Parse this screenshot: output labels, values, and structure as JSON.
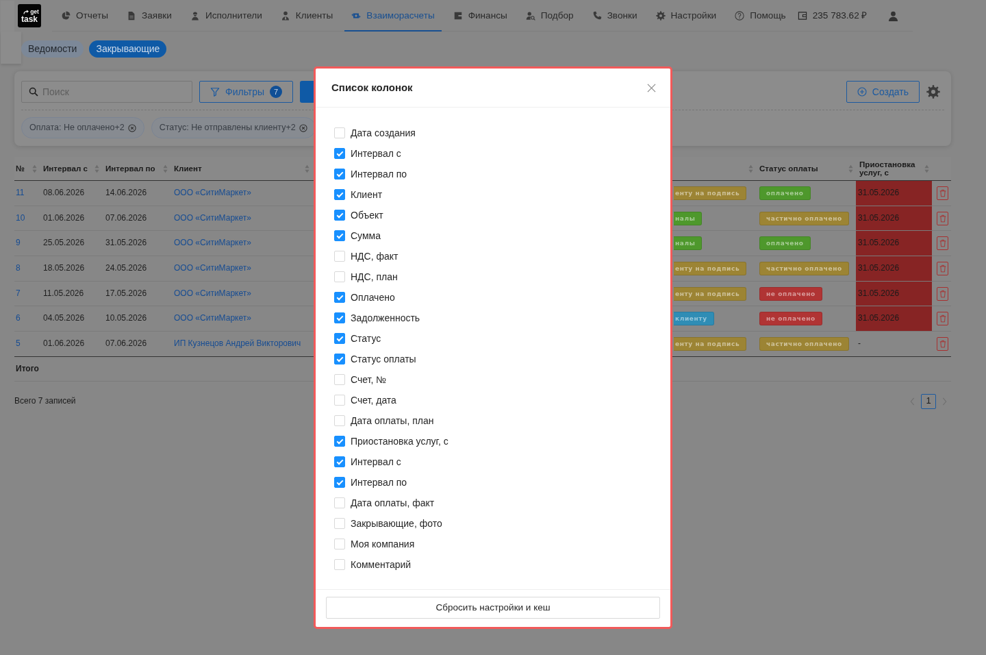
{
  "logo": {
    "line_1": "get",
    "line_2": "task"
  },
  "nav": {
    "items": [
      {
        "label": "Отчеты",
        "selected": false
      },
      {
        "label": "Заявки",
        "selected": false
      },
      {
        "label": "Исполнители",
        "selected": false
      },
      {
        "label": "Клиенты",
        "selected": false
      },
      {
        "label": "Взаиморасчеты",
        "selected": true
      },
      {
        "label": "Финансы",
        "selected": false
      },
      {
        "label": "Подбор",
        "selected": false
      },
      {
        "label": "Звонки",
        "selected": false
      },
      {
        "label": "Настройки",
        "selected": false
      },
      {
        "label": "Помощь",
        "selected": false
      }
    ],
    "balance": "235 783.62 ₽"
  },
  "subtabs": [
    {
      "label": "Ведомости",
      "selected": false
    },
    {
      "label": "Закрывающие",
      "selected": true
    }
  ],
  "toolbar": {
    "search": {
      "placeholder": "Поиск"
    },
    "filters_button": {
      "label": "Фильтры",
      "count": "7"
    },
    "create_button": {
      "label": "Создать"
    }
  },
  "active_filters": [
    {
      "label": "Оплата: Не оплачено+2"
    },
    {
      "label": "Статус: Не отправлены клиенту+2"
    }
  ],
  "table": {
    "columns": [
      {
        "label": "№",
        "sortable": true
      },
      {
        "label": "Интервал с",
        "sortable": true
      },
      {
        "label": "Интервал по",
        "sortable": true
      },
      {
        "label": "Клиент",
        "sortable": true
      },
      {
        "sortable": true
      },
      {
        "label": "Статус оплаты",
        "sortable": true
      },
      {
        "label": "Приостановка услуг, с",
        "sortable": true
      }
    ],
    "rows": [
      {
        "number": "11",
        "interval_from": "08.06.2026",
        "interval_to": "14.06.2026",
        "client": "ООО «СитиМаркет»",
        "status": {
          "text": "енту на подпись",
          "color": "#9c8434"
        },
        "payment_status": {
          "text": "оплачено",
          "color": "#4e982c"
        },
        "suspension_from": "31.05.2026",
        "highlighted": true
      },
      {
        "number": "10",
        "interval_from": "01.06.2026",
        "interval_to": "07.06.2026",
        "client": "ООО «СитиМаркет»",
        "status": {
          "text": "налы",
          "color": "#4e982c"
        },
        "payment_status": {
          "text": "частично оплачено",
          "color": "#9c8434"
        },
        "suspension_from": "31.05.2026",
        "highlighted": true
      },
      {
        "number": "9",
        "interval_from": "25.05.2026",
        "interval_to": "31.05.2026",
        "client": "ООО «СитиМаркет»",
        "status": {
          "text": "налы",
          "color": "#4e982c"
        },
        "payment_status": {
          "text": "оплачено",
          "color": "#4e982c"
        },
        "suspension_from": "31.05.2026",
        "highlighted": true
      },
      {
        "number": "8",
        "interval_from": "18.05.2026",
        "interval_to": "24.05.2026",
        "client": "ООО «СитиМаркет»",
        "status": {
          "text": "енту на подпись",
          "color": "#9c8434"
        },
        "payment_status": {
          "text": "частично оплачено",
          "color": "#9c8434"
        },
        "suspension_from": "31.05.2026",
        "highlighted": true
      },
      {
        "number": "7",
        "interval_from": "11.05.2026",
        "interval_to": "17.05.2026",
        "client": "ООО «СитиМаркет»",
        "status": {
          "text": "енту на подпись",
          "color": "#9c8434"
        },
        "payment_status": {
          "text": "не оплачено",
          "color": "#b03434"
        },
        "suspension_from": "31.05.2026",
        "highlighted": true
      },
      {
        "number": "6",
        "interval_from": "04.05.2026",
        "interval_to": "10.05.2026",
        "client": "ООО «СитиМаркет»",
        "status": {
          "text": "клиенту",
          "color": "#2f8db5"
        },
        "payment_status": {
          "text": "не оплачено",
          "color": "#b03434"
        },
        "suspension_from": "31.05.2026",
        "highlighted": true
      },
      {
        "number": "5",
        "interval_from": "01.06.2026",
        "interval_to": "07.06.2026",
        "client": "ИП Кузнецов Андрей Викторович",
        "status": {
          "text": "енту на подпись",
          "color": "#9c8434"
        },
        "payment_status": {
          "text": "частично оплачено",
          "color": "#9c8434"
        },
        "suspension_from": "-",
        "highlighted": false
      }
    ],
    "total_label": "Итого"
  },
  "footer": {
    "records": "Всего 7 записей",
    "pages": [
      {
        "label": "1",
        "selected": true
      }
    ]
  },
  "dialog": {
    "title": "Список колонок",
    "items": [
      {
        "label": "Дата создания",
        "checked": false
      },
      {
        "label": "Интервал с",
        "checked": true
      },
      {
        "label": "Интервал по",
        "checked": true
      },
      {
        "label": "Клиент",
        "checked": true
      },
      {
        "label": "Объект",
        "checked": true
      },
      {
        "label": "Сумма",
        "checked": true
      },
      {
        "label": "НДС, факт",
        "checked": false
      },
      {
        "label": "НДС, план",
        "checked": false
      },
      {
        "label": "Оплачено",
        "checked": true
      },
      {
        "label": "Задолженность",
        "checked": true
      },
      {
        "label": "Статус",
        "checked": true
      },
      {
        "label": "Статус оплаты",
        "checked": true
      },
      {
        "label": "Счет, №",
        "checked": false
      },
      {
        "label": "Счет, дата",
        "checked": false
      },
      {
        "label": "Дата оплаты, план",
        "checked": false
      },
      {
        "label": "Приостановка услуг, с",
        "checked": true
      },
      {
        "label": "Интервал с",
        "checked": true
      },
      {
        "label": "Интервал по",
        "checked": true
      },
      {
        "label": "Дата оплаты, факт",
        "checked": false
      },
      {
        "label": "Закрывающие, фото",
        "checked": false
      },
      {
        "label": "Моя компания",
        "checked": false
      },
      {
        "label": "Комментарий",
        "checked": false
      }
    ],
    "reset_button": "Сбросить настройки и кеш"
  }
}
